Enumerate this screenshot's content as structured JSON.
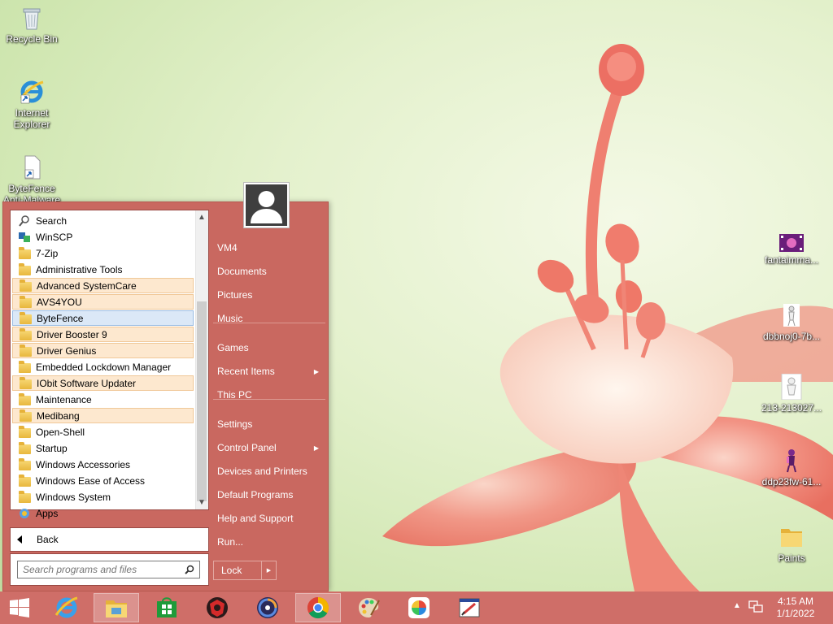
{
  "desktop": {
    "icons_left": [
      {
        "label": "Recycle Bin",
        "icon": "recycle-bin-icon"
      },
      {
        "label": "Internet Explorer",
        "icon": "internet-explorer-icon"
      },
      {
        "label": "ByteFence Anti-Malware",
        "icon": "bytefence-shortcut-icon"
      }
    ],
    "icons_right": [
      {
        "label": "fantaimma...",
        "icon": "video-file-icon"
      },
      {
        "label": "dbbnoj0-7b...",
        "icon": "image-file-icon"
      },
      {
        "label": "213-213027...",
        "icon": "image-file-icon"
      },
      {
        "label": "ddp23fw-61...",
        "icon": "image-file-icon"
      },
      {
        "label": "Paints",
        "icon": "folder-icon"
      }
    ]
  },
  "start_menu": {
    "programs": [
      {
        "label": "Search",
        "icon": "search-icon",
        "state": ""
      },
      {
        "label": "WinSCP",
        "icon": "winscp-icon",
        "state": ""
      },
      {
        "label": "7-Zip",
        "icon": "folder-icon",
        "state": ""
      },
      {
        "label": "Administrative Tools",
        "icon": "folder-icon",
        "state": ""
      },
      {
        "label": "Advanced SystemCare",
        "icon": "folder-icon",
        "state": "highlight"
      },
      {
        "label": "AVS4YOU",
        "icon": "folder-icon",
        "state": "highlight"
      },
      {
        "label": "ByteFence",
        "icon": "folder-icon",
        "state": "selected"
      },
      {
        "label": "Driver Booster 9",
        "icon": "folder-icon",
        "state": "highlight"
      },
      {
        "label": "Driver Genius",
        "icon": "folder-icon",
        "state": "highlight"
      },
      {
        "label": "Embedded Lockdown Manager",
        "icon": "folder-icon",
        "state": ""
      },
      {
        "label": "IObit Software Updater",
        "icon": "folder-icon",
        "state": "highlight"
      },
      {
        "label": "Maintenance",
        "icon": "folder-icon",
        "state": ""
      },
      {
        "label": "Medibang",
        "icon": "folder-icon",
        "state": "highlight"
      },
      {
        "label": "Open-Shell",
        "icon": "folder-icon",
        "state": ""
      },
      {
        "label": "Startup",
        "icon": "folder-icon",
        "state": ""
      },
      {
        "label": "Windows Accessories",
        "icon": "folder-icon",
        "state": ""
      },
      {
        "label": "Windows Ease of Access",
        "icon": "folder-icon",
        "state": ""
      },
      {
        "label": "Windows System",
        "icon": "folder-icon",
        "state": ""
      },
      {
        "label": "Apps",
        "icon": "apps-icon",
        "state": ""
      }
    ],
    "back_label": "Back",
    "search_placeholder": "Search programs and files",
    "right_items": [
      {
        "label": "VM4",
        "submenu": false
      },
      {
        "label": "Documents",
        "submenu": false
      },
      {
        "label": "Pictures",
        "submenu": false
      },
      {
        "label": "Music",
        "submenu": false
      },
      {
        "label": "Games",
        "submenu": false
      },
      {
        "label": "Recent Items",
        "submenu": true
      },
      {
        "label": "This PC",
        "submenu": false
      },
      {
        "label": "Settings",
        "submenu": false
      },
      {
        "label": "Control Panel",
        "submenu": true
      },
      {
        "label": "Devices and Printers",
        "submenu": false
      },
      {
        "label": "Default Programs",
        "submenu": false
      },
      {
        "label": "Help and Support",
        "submenu": false
      },
      {
        "label": "Run...",
        "submenu": false
      }
    ],
    "lock_label": "Lock"
  },
  "taskbar": {
    "apps": [
      {
        "name": "start-button",
        "icon": "windows-logo-icon"
      },
      {
        "name": "internet-explorer",
        "icon": "internet-explorer-icon"
      },
      {
        "name": "file-explorer",
        "icon": "file-explorer-icon"
      },
      {
        "name": "store",
        "icon": "store-icon"
      },
      {
        "name": "iobit-malware-fighter",
        "icon": "iobit-icon"
      },
      {
        "name": "advanced-systemcare",
        "icon": "asc-icon"
      },
      {
        "name": "chrome",
        "icon": "chrome-icon"
      },
      {
        "name": "paint-palette",
        "icon": "palette-icon"
      },
      {
        "name": "medibang",
        "icon": "medibang-icon"
      },
      {
        "name": "paint-tool",
        "icon": "paint-tool-icon"
      }
    ],
    "time": "4:15 AM",
    "date": "1/1/2022"
  },
  "colors": {
    "accent": "#c96860",
    "taskbar": "#cf6e68",
    "highlight": "#fde8cf",
    "selected": "#dbe8f7"
  }
}
